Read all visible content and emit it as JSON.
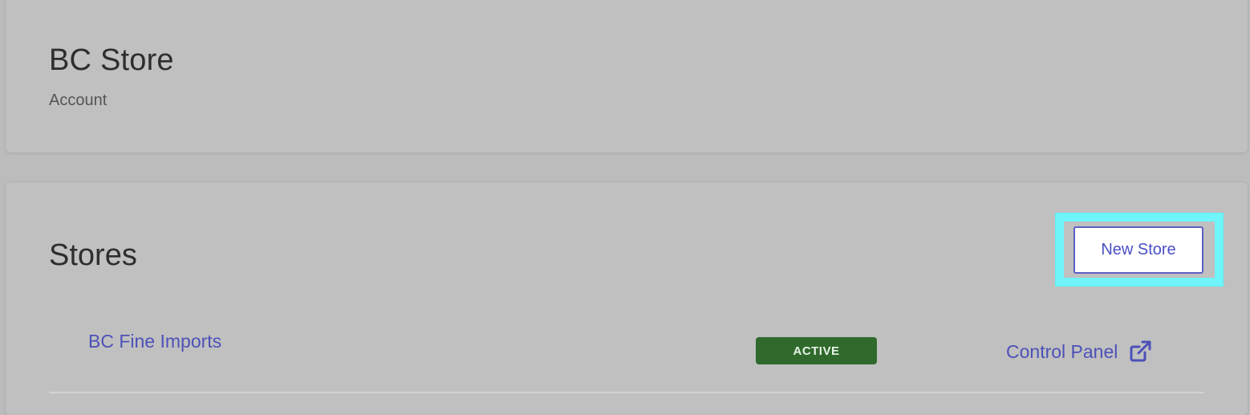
{
  "account": {
    "title": "BC Store",
    "subtitle": "Account"
  },
  "stores": {
    "title": "Stores",
    "new_store_label": "New Store",
    "rows": [
      {
        "name": "BC Fine Imports",
        "status": "ACTIVE",
        "action_label": "Control Panel",
        "action_icon": "external-link-icon"
      }
    ]
  },
  "colors": {
    "background": "#bcbcbc",
    "card": "#c0c0c0",
    "link": "#4c51b8",
    "active_badge": "#2f6a2c",
    "highlight": "#6ff4fa"
  }
}
